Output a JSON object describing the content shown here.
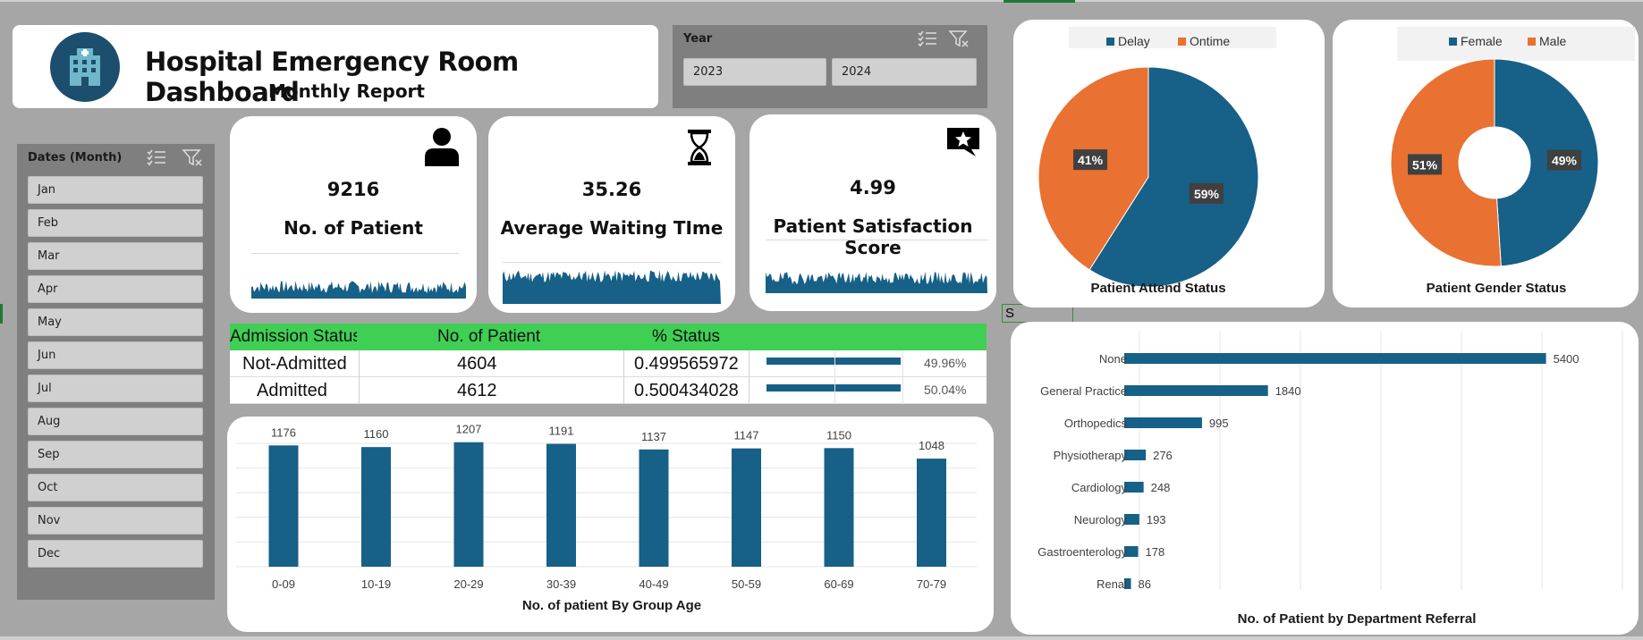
{
  "title": {
    "main": "Hospital Emergency Room Dashboard",
    "sub": "Monthly Report"
  },
  "year_slicer": {
    "header": "Year",
    "options": [
      "2023",
      "2024"
    ]
  },
  "month_slicer": {
    "header": "Dates (Month)",
    "options": [
      "Jan",
      "Feb",
      "Mar",
      "Apr",
      "May",
      "Jun",
      "Jul",
      "Aug",
      "Sep",
      "Oct",
      "Nov",
      "Dec"
    ]
  },
  "kpis": {
    "patients": {
      "value": "9216",
      "label": "No. of Patient",
      "icon": "person-icon"
    },
    "waiting": {
      "value": "35.26",
      "label": "Average Waiting TIme",
      "icon": "hourglass-icon"
    },
    "satisfaction": {
      "value": "4.99",
      "label": "Patient Satisfaction Score",
      "icon": "star-speech-icon"
    }
  },
  "admission_table": {
    "headers": [
      "Admission Status",
      "No. of Patient",
      "% Status"
    ],
    "rows": [
      {
        "status": "Not-Admitted",
        "count": "4604",
        "pct_raw": "0.499565972",
        "pct_label": "49.96%",
        "pct_value": 0.4996
      },
      {
        "status": "Admitted",
        "count": "4612",
        "pct_raw": "0.500434028",
        "pct_label": "50.04%",
        "pct_value": 0.5004
      }
    ]
  },
  "cell_fragment": "S",
  "colors": {
    "blue": "#176087",
    "orange": "#e97132",
    "green_header": "#3fcf55",
    "panel_gray": "#a6a6a6"
  },
  "chart_data": [
    {
      "id": "attend",
      "type": "pie",
      "title": "Patient Attend Status",
      "legend_position": "top",
      "series": [
        {
          "name": "Delay",
          "value": 59,
          "label": "59%",
          "color": "#176087"
        },
        {
          "name": "Ontime",
          "value": 41,
          "label": "41%",
          "color": "#e97132"
        }
      ]
    },
    {
      "id": "gender",
      "type": "pie",
      "donut": true,
      "title": "Patient Gender Status",
      "legend_position": "top",
      "series": [
        {
          "name": "Female",
          "value": 49,
          "label": "49%",
          "color": "#176087"
        },
        {
          "name": "Male",
          "value": 51,
          "label": "51%",
          "color": "#e97132"
        }
      ]
    },
    {
      "id": "age",
      "type": "bar",
      "title": "No. of patient By Group Age",
      "categories": [
        "0-09",
        "10-19",
        "20-29",
        "30-39",
        "40-49",
        "50-59",
        "60-69",
        "70-79"
      ],
      "values": [
        1176,
        1160,
        1207,
        1191,
        1137,
        1147,
        1150,
        1048
      ],
      "grid": true,
      "color": "#176087"
    },
    {
      "id": "dept",
      "type": "bar",
      "orientation": "horizontal",
      "title": "No. of Patient by Department  Referral",
      "categories": [
        "None",
        "General Practice",
        "Orthopedics",
        "Physiotherapy",
        "Cardiology",
        "Neurology",
        "Gastroenterology",
        "Renal"
      ],
      "values": [
        5400,
        1840,
        995,
        276,
        248,
        193,
        178,
        86
      ],
      "grid": true,
      "color": "#176087"
    }
  ]
}
